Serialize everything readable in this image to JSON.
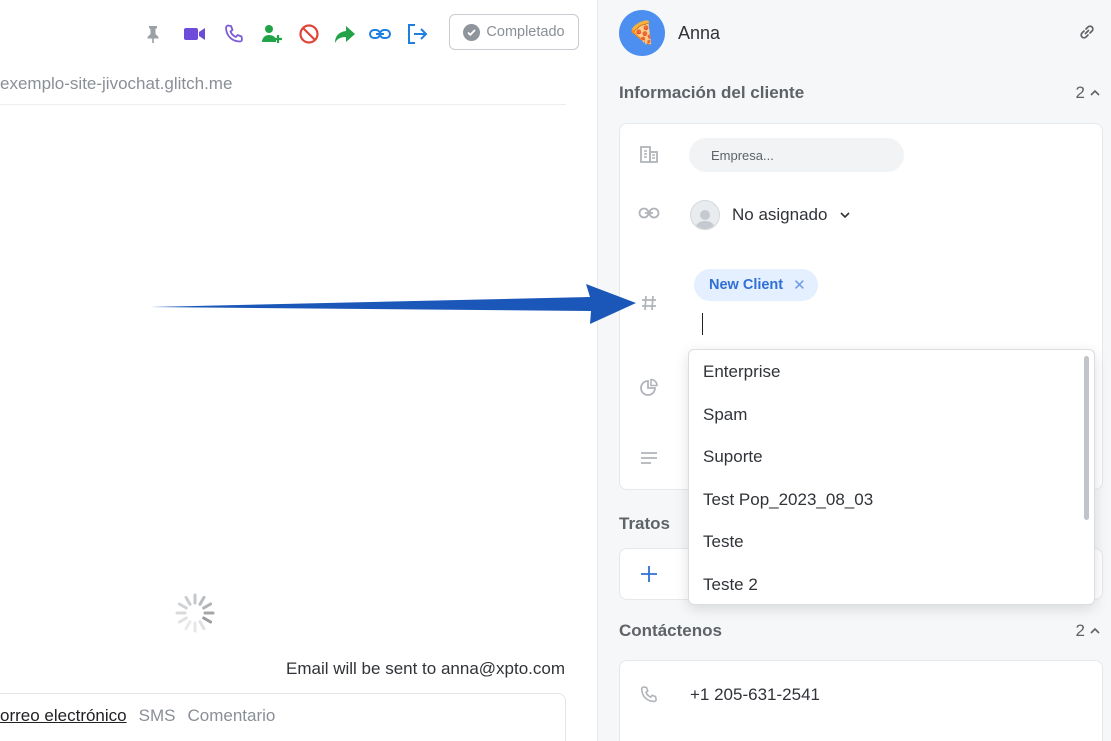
{
  "toolbar": {
    "icons": [
      "pin-icon",
      "video-icon",
      "phone-icon",
      "add-user-icon",
      "block-icon",
      "forward-icon",
      "link-icon",
      "exit-icon"
    ],
    "completed_label": "Completado"
  },
  "chat": {
    "site_url": "exemplo-site-jivochat.glitch.me",
    "email_note": "Email will be sent to anna@xpto.com",
    "composer_tabs": [
      "orreo electrónico",
      "SMS",
      "Comentario"
    ]
  },
  "client": {
    "avatar_emoji": "🍕",
    "name": "Anna",
    "info_section": {
      "title": "Información del cliente",
      "count": "2"
    },
    "company_placeholder": "Empresa...",
    "assignee": "No asignado",
    "tag": "New Client",
    "tag_options": [
      "Enterprise",
      "Spam",
      "Suporte",
      "Test Pop_2023_08_03",
      "Teste",
      "Teste 2"
    ],
    "deals_section": {
      "title": "Tratos"
    },
    "contacts_section": {
      "title": "Contáctenos",
      "count": "2"
    },
    "phone": "+1 205-631-2541"
  },
  "colors": {
    "accent_blue": "#2f6fd6",
    "video_purple": "#6c4cd8",
    "add_user_green": "#22a34a",
    "block_red": "#e0453a",
    "arrow_blue": "#1a57b8"
  }
}
